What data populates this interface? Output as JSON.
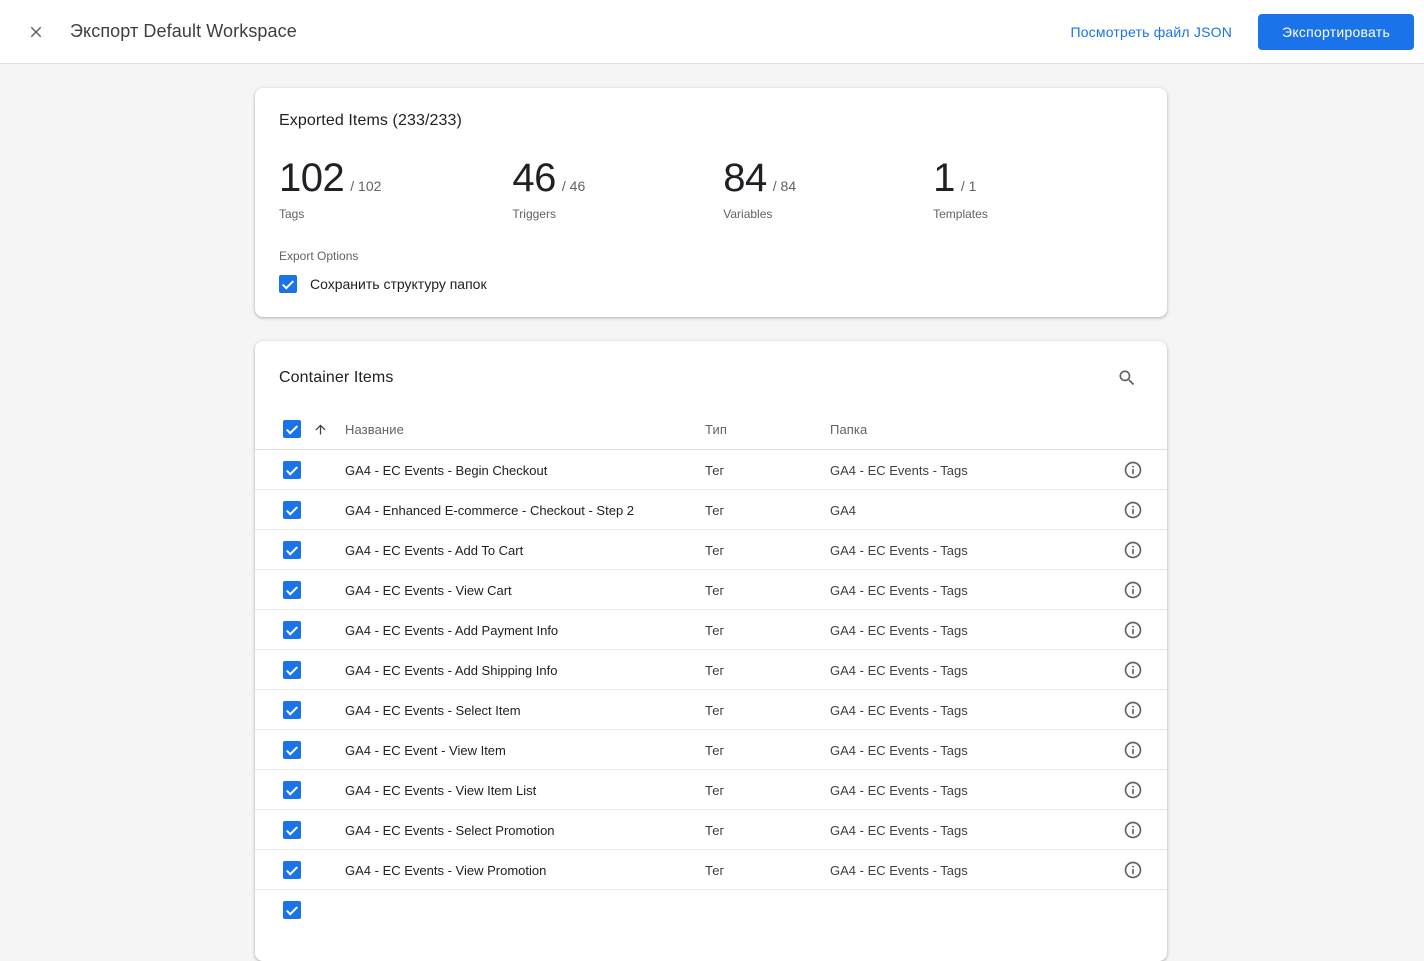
{
  "colors": {
    "accent": "#1a73e8",
    "text_primary": "#202124",
    "text_secondary": "#5f6368"
  },
  "header": {
    "title": "Экспорт Default Workspace",
    "json_link": "Посмотреть файл JSON",
    "export_button": "Экспортировать"
  },
  "summary_card": {
    "title": "Exported Items (233/233)",
    "export_options_label": "Export Options",
    "keep_folders_label": "Сохранить структуру папок",
    "stats": [
      {
        "value": "102",
        "total": "/ 102",
        "label": "Tags"
      },
      {
        "value": "46",
        "total": "/ 46",
        "label": "Triggers"
      },
      {
        "value": "84",
        "total": "/ 84",
        "label": "Variables"
      },
      {
        "value": "1",
        "total": "/ 1",
        "label": "Templates"
      }
    ]
  },
  "container_card": {
    "title": "Container Items",
    "columns": {
      "name": "Название",
      "type": "Тип",
      "folder": "Папка"
    },
    "rows": [
      {
        "name": "GA4 - EC Events - Begin Checkout",
        "type": "Тег",
        "folder": "GA4 - EC Events - Tags"
      },
      {
        "name": "GA4 - Enhanced E-commerce - Checkout - Step 2",
        "type": "Тег",
        "folder": "GA4"
      },
      {
        "name": "GA4 - EC Events - Add To Cart",
        "type": "Тег",
        "folder": "GA4 - EC Events - Tags"
      },
      {
        "name": "GA4 - EC Events - View Cart",
        "type": "Тег",
        "folder": "GA4 - EC Events - Tags"
      },
      {
        "name": "GA4 - EC Events - Add Payment Info",
        "type": "Тег",
        "folder": "GA4 - EC Events - Tags"
      },
      {
        "name": "GA4 - EC Events - Add Shipping Info",
        "type": "Тег",
        "folder": "GA4 - EC Events - Tags"
      },
      {
        "name": "GA4 - EC Events - Select Item",
        "type": "Тег",
        "folder": "GA4 - EC Events - Tags"
      },
      {
        "name": "GA4 - EC Event - View Item",
        "type": "Тег",
        "folder": "GA4 - EC Events - Tags"
      },
      {
        "name": "GA4 - EC Events - View Item List",
        "type": "Тег",
        "folder": "GA4 - EC Events - Tags"
      },
      {
        "name": "GA4 - EC Events - Select Promotion",
        "type": "Тег",
        "folder": "GA4 - EC Events - Tags"
      },
      {
        "name": "GA4 - EC Events - View Promotion",
        "type": "Тег",
        "folder": "GA4 - EC Events - Tags"
      }
    ]
  }
}
